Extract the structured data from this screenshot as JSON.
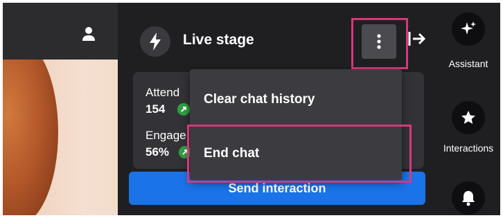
{
  "live_stage": {
    "title": "Live stage",
    "stats": {
      "attendees_label": "Attend",
      "attendees_value": "154",
      "engagement_label": "Engage",
      "engagement_value": "56%"
    },
    "send_interaction_label": "Send interaction"
  },
  "overflow_menu": {
    "items": [
      {
        "label": "Clear chat history"
      },
      {
        "label": "End chat"
      }
    ]
  },
  "right_rail": {
    "items": [
      {
        "label": "Assistant",
        "icon": "sparkle-icon"
      },
      {
        "label": "Interactions",
        "icon": "star-icon"
      },
      {
        "label": "",
        "icon": "bell-icon"
      }
    ]
  },
  "colors": {
    "highlight": "#d6387c",
    "primary_button": "#1a73e8",
    "trend_up": "#2ea043",
    "panel_bg": "#1f1f22"
  }
}
